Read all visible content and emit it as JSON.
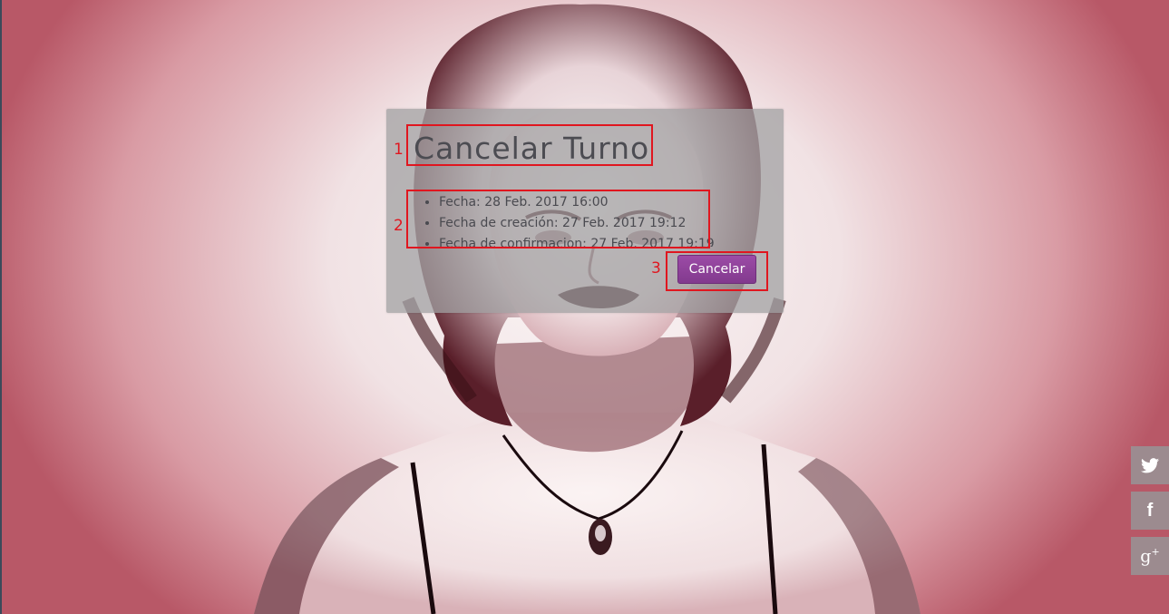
{
  "modal": {
    "title": "Cancelar Turno",
    "details": [
      "Fecha: 28 Feb. 2017 16:00",
      "Fecha de creación: 27 Feb. 2017 19:12",
      "Fecha de confirmacion: 27 Feb. 2017 19:19"
    ],
    "cancel_button_label": "Cancelar"
  },
  "annotations": [
    {
      "label": "1"
    },
    {
      "label": "2"
    },
    {
      "label": "3"
    }
  ],
  "social": [
    {
      "name": "twitter-icon"
    },
    {
      "name": "facebook-icon",
      "glyph": "f"
    },
    {
      "name": "google-plus-icon",
      "glyph": "g",
      "sup": "+"
    }
  ],
  "colors": {
    "accent_button": "#8e43a0",
    "annotation": "#e0161f"
  }
}
